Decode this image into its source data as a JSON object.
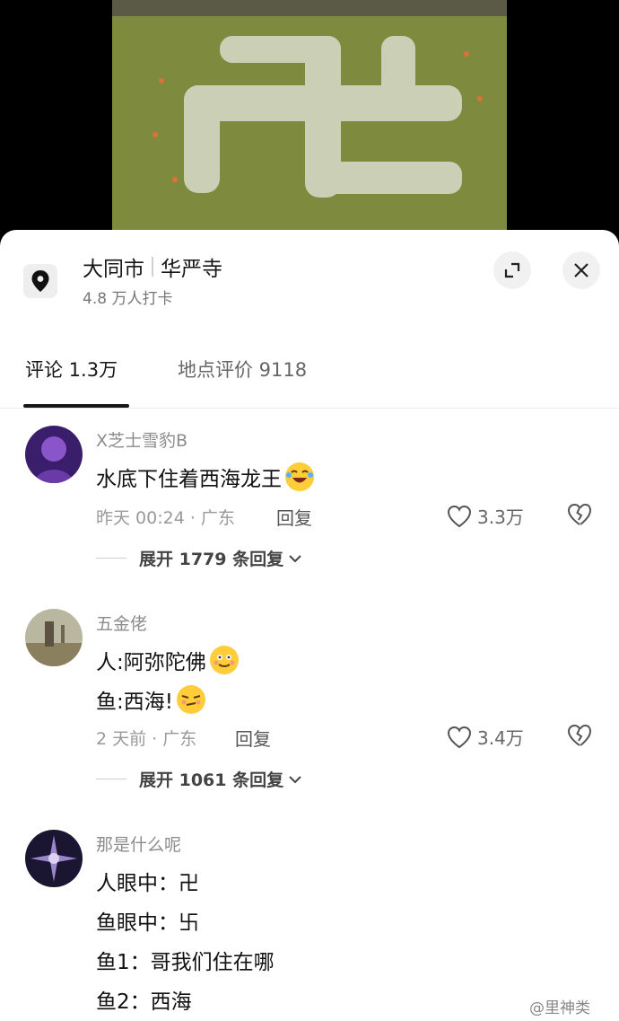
{
  "location": {
    "city": "大同市",
    "place": "华严寺",
    "checkins": "4.8 万人打卡",
    "icon": "location-pin-icon"
  },
  "tabs": [
    {
      "label": "评论 1.3万",
      "active": true
    },
    {
      "label": "地点评价 9118",
      "active": false
    }
  ],
  "comments": [
    {
      "user": "X芝士雪豹B",
      "lines": [
        "水底下住着西海龙王"
      ],
      "meta": "昨天 00:24 · 广东",
      "reply": "回复",
      "likes": "3.3万",
      "expand": "展开 1779 条回复"
    },
    {
      "user": "五金佬",
      "lines": [
        "人:阿弥陀佛",
        "鱼:西海!"
      ],
      "meta": "2 天前 · 广东",
      "reply": "回复",
      "likes": "3.4万",
      "expand": "展开 1061 条回复"
    },
    {
      "user": "那是什么呢",
      "lines": [
        "人眼中：卍",
        "鱼眼中：卐",
        "鱼1：哥我们住在哪",
        "鱼2：西海"
      ]
    }
  ],
  "watermark": "@里神类",
  "colors": {
    "sheet": "#ffffff",
    "text_primary": "#161616",
    "text_secondary": "#8c8c8c",
    "pond": "#7d8a3c"
  }
}
